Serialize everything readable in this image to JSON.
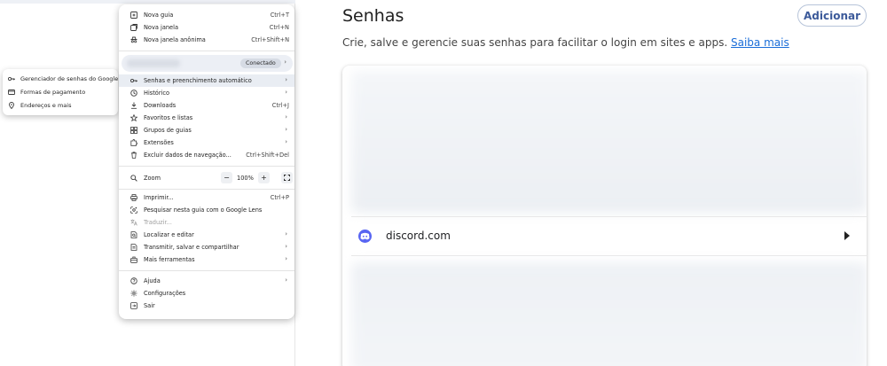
{
  "page": {
    "title": "Senhas",
    "add_button": "Adicionar",
    "description": "Crie, salve e gerencie suas senhas para facilitar o login em sites e apps.",
    "learn_more": "Saiba mais",
    "entries": [
      {
        "site": "discord.com",
        "icon": "discord-icon"
      }
    ]
  },
  "menu": {
    "items": [
      {
        "label": "Nova guia",
        "shortcut": "Ctrl+T",
        "icon": "new-tab-icon"
      },
      {
        "label": "Nova janela",
        "shortcut": "Ctrl+N",
        "icon": "new-window-icon"
      },
      {
        "label": "Nova janela anônima",
        "shortcut": "Ctrl+Shift+N",
        "icon": "incognito-icon"
      }
    ],
    "profile_status": "Conectado",
    "group2": [
      {
        "label": "Senhas e preenchimento automático",
        "icon": "key-icon"
      },
      {
        "label": "Histórico",
        "icon": "history-icon"
      },
      {
        "label": "Downloads",
        "shortcut": "Ctrl+J",
        "icon": "download-icon"
      },
      {
        "label": "Favoritos e listas",
        "icon": "star-icon"
      },
      {
        "label": "Grupos de guias",
        "icon": "tab-groups-icon"
      },
      {
        "label": "Extensões",
        "icon": "extension-icon"
      },
      {
        "label": "Excluir dados de navegação...",
        "shortcut": "Ctrl+Shift+Del",
        "icon": "trash-icon"
      }
    ],
    "zoom": {
      "label": "Zoom",
      "value": "100%",
      "minus": "−",
      "plus": "+"
    },
    "group3": [
      {
        "label": "Imprimir...",
        "shortcut": "Ctrl+P",
        "icon": "print-icon"
      },
      {
        "label": "Pesquisar nesta guia com o Google Lens",
        "icon": "lens-icon"
      },
      {
        "label": "Traduzir...",
        "icon": "translate-icon"
      },
      {
        "label": "Localizar e editar",
        "icon": "find-icon"
      },
      {
        "label": "Transmitir, salvar e compartilhar",
        "icon": "cast-icon"
      },
      {
        "label": "Mais ferramentas",
        "icon": "toolbox-icon"
      }
    ],
    "group4": [
      {
        "label": "Ajuda",
        "icon": "help-icon"
      },
      {
        "label": "Configurações",
        "icon": "settings-icon"
      },
      {
        "label": "Sair",
        "icon": "exit-icon"
      }
    ]
  },
  "submenu": {
    "items": [
      {
        "label": "Gerenciador de senhas do Google",
        "icon": "key-icon"
      },
      {
        "label": "Formas de pagamento",
        "icon": "card-icon"
      },
      {
        "label": "Endereços e mais",
        "icon": "location-icon"
      }
    ]
  }
}
